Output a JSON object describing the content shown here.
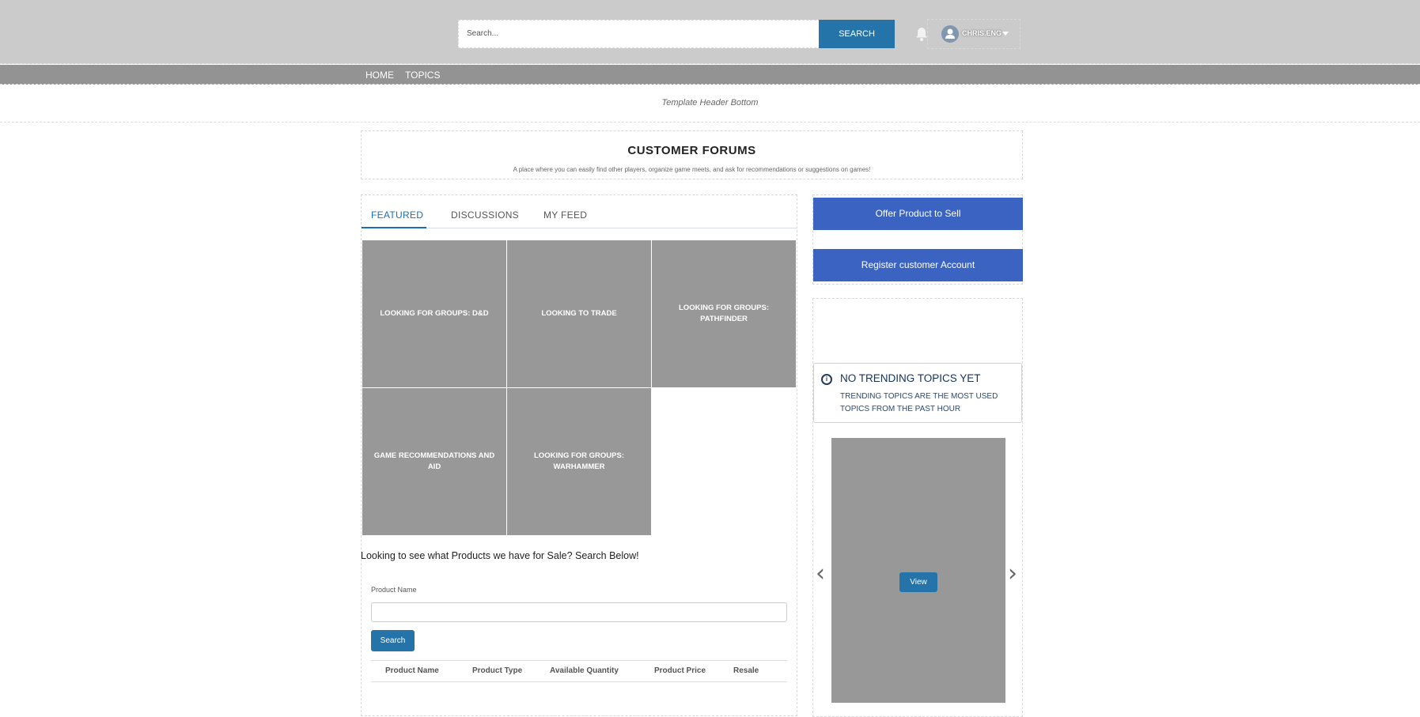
{
  "header": {
    "search_placeholder": "Search...",
    "search_button": "SEARCH",
    "user_name": "CHRIS.ENG"
  },
  "nav": {
    "items": [
      "HOME",
      "TOPICS"
    ]
  },
  "template_header_bottom": "Template Header Bottom",
  "forums": {
    "title": "CUSTOMER FORUMS",
    "subtitle": "A place where you can easily find other players, organize game meets, and ask for recommendations or suggestions on games!"
  },
  "tabs": [
    "FEATURED",
    "DISCUSSIONS",
    "MY FEED"
  ],
  "tiles": [
    "LOOKING FOR GROUPS: D&D",
    "LOOKING TO TRADE",
    "LOOKING FOR GROUPS: PATHFINDER",
    "GAME RECOMMENDATIONS AND AID",
    "LOOKING FOR GROUPS: WARHAMMER"
  ],
  "products": {
    "prompt": "Looking to see what Products we have for Sale? Search Below!",
    "label": "Product Name",
    "value": "",
    "search_button": "Search",
    "columns": [
      "Product Name",
      "Product Type",
      "Available Quantity",
      "Product Price",
      "Resale"
    ]
  },
  "sidebar": {
    "offer_button": "Offer Product to Sell",
    "register_button": "Register customer Account",
    "trending_title": "NO TRENDING TOPICS YET",
    "trending_sub": "TRENDING TOPICS ARE THE MOST USED TOPICS FROM THE PAST HOUR",
    "info_glyph": "i",
    "view_button": "View",
    "prev_glyph": "‹",
    "next_glyph": "›"
  },
  "colors": {
    "accent": "#2574a9",
    "button_blue": "#3b64c2",
    "tile": "#989898"
  }
}
